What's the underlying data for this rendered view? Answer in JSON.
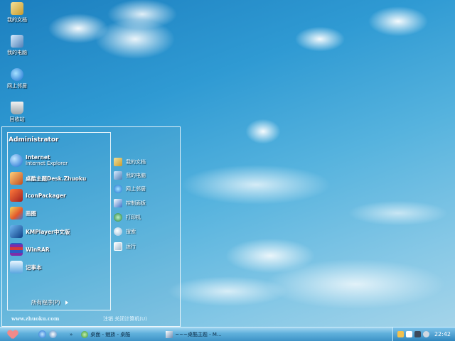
{
  "desktop": {
    "icons": [
      {
        "label": "我的文档",
        "icon": "my-documents-icon"
      },
      {
        "label": "我的电脑",
        "icon": "my-computer-icon"
      },
      {
        "label": "网上邻居",
        "icon": "network-icon"
      },
      {
        "label": "回收站",
        "icon": "recycle-bin-icon"
      }
    ]
  },
  "start_menu": {
    "user": "Administrator",
    "programs": [
      {
        "name": "Internet",
        "sub": "Internet Explorer",
        "icon": "internet-explorer-icon"
      },
      {
        "name": "桌酷主题Desk.Zhuoku",
        "sub": "",
        "icon": "zhuoku-theme-icon"
      },
      {
        "name": "IconPackager",
        "sub": "",
        "icon": "iconpackager-icon"
      },
      {
        "name": "画图",
        "sub": "",
        "icon": "paint-icon"
      },
      {
        "name": "KMPlayer中文版",
        "sub": "",
        "icon": "kmplayer-icon"
      },
      {
        "name": "WinRAR",
        "sub": "",
        "icon": "winrar-icon"
      },
      {
        "name": "记事本",
        "sub": "",
        "icon": "notepad-icon"
      }
    ],
    "all_programs": "所有程序(P)",
    "url": "www.zhuoku.com",
    "logoff": "注销  关闭计算机(U)",
    "right_items": [
      {
        "label": "我的文档",
        "icon": "my-documents-icon"
      },
      {
        "label": "我的电脑",
        "icon": "my-computer-icon"
      },
      {
        "label": "网上邻居",
        "icon": "network-icon"
      },
      {
        "label": "控制面板",
        "icon": "control-panel-icon"
      },
      {
        "label": "打印机",
        "icon": "printer-icon"
      },
      {
        "label": "搜索",
        "icon": "search-icon"
      },
      {
        "label": "运行",
        "icon": "run-icon"
      }
    ]
  },
  "taskbar": {
    "tasks": [
      {
        "label": "桌面 - 魅族 - 桌酷",
        "icon": "folder-icon"
      },
      {
        "label": "~~~桌酷主题 - M...",
        "icon": "window-icon"
      }
    ],
    "clock": "22:42"
  }
}
